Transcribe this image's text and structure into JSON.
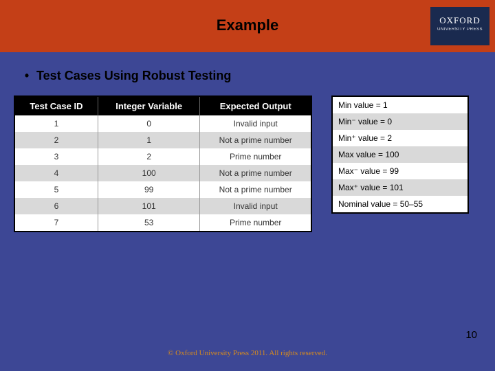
{
  "header": {
    "title": "Example",
    "brand": "OXFORD",
    "brand_sub": "UNIVERSITY PRESS"
  },
  "bullet_text": "Test Cases Using Robust Testing",
  "main_table": {
    "headers": [
      "Test Case ID",
      "Integer Variable",
      "Expected Output"
    ],
    "rows": [
      [
        "1",
        "0",
        "Invalid input"
      ],
      [
        "2",
        "1",
        "Not a prime number"
      ],
      [
        "3",
        "2",
        "Prime number"
      ],
      [
        "4",
        "100",
        "Not a prime number"
      ],
      [
        "5",
        "99",
        "Not a prime number"
      ],
      [
        "6",
        "101",
        "Invalid input"
      ],
      [
        "7",
        "53",
        "Prime number"
      ]
    ]
  },
  "side_table": {
    "rows": [
      "Min value = 1",
      "Min⁻ value = 0",
      "Min⁺ value = 2",
      "Max value = 100",
      "Max⁻ value = 99",
      "Max⁺ value = 101",
      "Nominal value = 50–55"
    ]
  },
  "footer": "© Oxford University Press 2011. All rights reserved.",
  "page_number": "10"
}
